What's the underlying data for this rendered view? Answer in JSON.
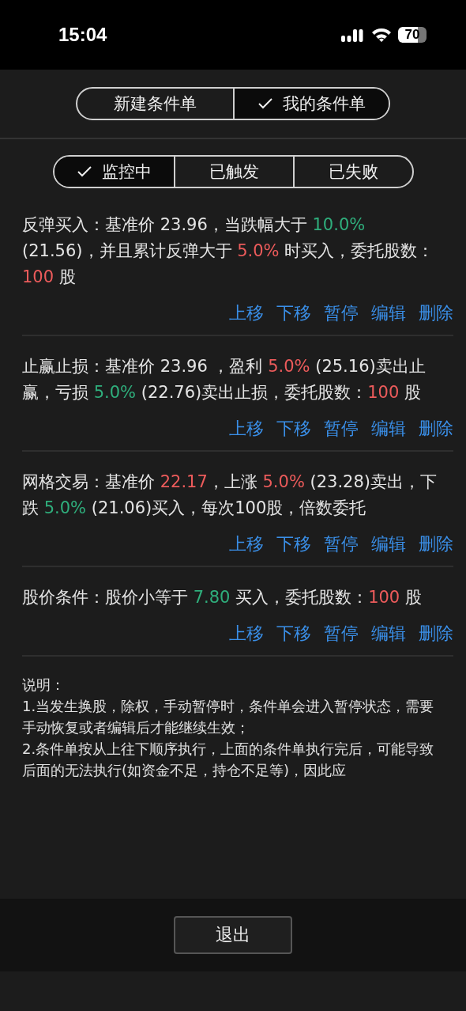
{
  "status_bar": {
    "time": "15:04",
    "battery": "70"
  },
  "mode_tabs": [
    {
      "label": "新建条件单",
      "selected": false
    },
    {
      "label": "我的条件单",
      "selected": true
    }
  ],
  "filter_tabs": [
    {
      "label": "监控中",
      "selected": true
    },
    {
      "label": "已触发",
      "selected": false
    },
    {
      "label": "已失败",
      "selected": false
    }
  ],
  "conditions": [
    {
      "segments": [
        {
          "kind": "plain",
          "text": "反弹买入：基准价 23.96，当跌幅大于 "
        },
        {
          "kind": "fall",
          "text": "10.0%"
        },
        {
          "kind": "plain",
          "text": " (21.56)，并且累计反弹大于 "
        },
        {
          "kind": "rise",
          "text": "5.0%"
        },
        {
          "kind": "plain",
          "text": " 时买入，委托股数："
        },
        {
          "kind": "rise",
          "text": "100"
        },
        {
          "kind": "plain",
          "text": " 股"
        }
      ],
      "actions": [
        "上移",
        "下移",
        "暂停",
        "编辑",
        "删除"
      ]
    },
    {
      "segments": [
        {
          "kind": "plain",
          "text": "止赢止损：基准价 23.96 ，盈利 "
        },
        {
          "kind": "rise",
          "text": "5.0%"
        },
        {
          "kind": "plain",
          "text": " (25.16)卖出止赢，亏损 "
        },
        {
          "kind": "fall",
          "text": "5.0%"
        },
        {
          "kind": "plain",
          "text": " (22.76)卖出止损，委托股数："
        },
        {
          "kind": "rise",
          "text": "100"
        },
        {
          "kind": "plain",
          "text": " 股"
        }
      ],
      "actions": [
        "上移",
        "下移",
        "暂停",
        "编辑",
        "删除"
      ]
    },
    {
      "segments": [
        {
          "kind": "plain",
          "text": "网格交易：基准价 "
        },
        {
          "kind": "rise",
          "text": "22.17"
        },
        {
          "kind": "plain",
          "text": "，上涨 "
        },
        {
          "kind": "rise",
          "text": "5.0%"
        },
        {
          "kind": "plain",
          "text": " (23.28)卖出，下跌 "
        },
        {
          "kind": "fall",
          "text": "5.0%"
        },
        {
          "kind": "plain",
          "text": " (21.06)买入，每次100股，倍数委托"
        }
      ],
      "actions": [
        "上移",
        "下移",
        "暂停",
        "编辑",
        "删除"
      ]
    },
    {
      "segments": [
        {
          "kind": "plain",
          "text": "股价条件：股价小等于 "
        },
        {
          "kind": "fall",
          "text": "7.80"
        },
        {
          "kind": "plain",
          "text": " 买入，委托股数："
        },
        {
          "kind": "rise",
          "text": "100"
        },
        {
          "kind": "plain",
          "text": " 股"
        }
      ],
      "actions": [
        "上移",
        "下移",
        "暂停",
        "编辑",
        "删除"
      ]
    }
  ],
  "note": {
    "title": "说明：",
    "lines": [
      "1.当发生换股，除权，手动暂停时，条件单会进入暂停状态，需要手动恢复或者编辑后才能继续生效；",
      "2.条件单按从上往下顺序执行，上面的条件单执行完后，可能导致后面的无法执行(如资金不足，持仓不足等)，因此应"
    ]
  },
  "exit_button": "退出"
}
